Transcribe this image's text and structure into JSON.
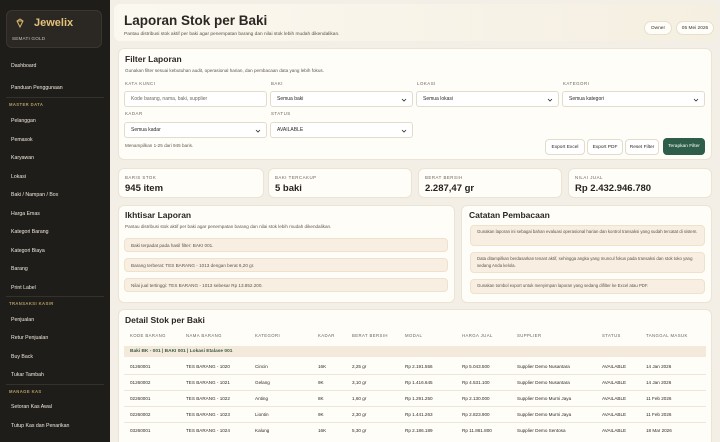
{
  "brand": {
    "name": "Jewelix",
    "subtitle": "SEMATI GOLD"
  },
  "sidebar": {
    "items_top": [
      "Dashboard",
      "Panduan Penggunaan"
    ],
    "section_master": "MASTER DATA",
    "items_master": [
      "Pelanggan",
      "Pemasok",
      "Karyawan",
      "Lokasi",
      "Baki / Nampan / Box",
      "Harga Emas",
      "Kategori Barang",
      "Kategori Biaya",
      "Barang",
      "Print Label"
    ],
    "section_transaksi": "TRANSAKSI KASIR",
    "items_transaksi": [
      "Penjualan",
      "Retur Penjualan",
      "Buy Back",
      "Tukar Tambah"
    ],
    "section_kas": "MANAGE KAS",
    "items_kas": [
      "Setoran Kas Awal",
      "Tutup Kas dan Penarikan"
    ]
  },
  "header": {
    "title": "Laporan Stok per Baki",
    "subtitle": "Pantau distribusi stok aktif per baki agar penempatan barang dan nilai stok lebih mudah dikendalikan.",
    "user": "Owner",
    "date": "05 Mei 2026"
  },
  "filter": {
    "title": "Filter Laporan",
    "subtitle": "Gunakan filter sesuai kebutuhan audit, operasional harian, dan pembacaan data yang lebih fokus.",
    "kata_kunci_label": "KATA KUNCI",
    "kata_kunci_placeholder": "Kode barang, nama, baki, supplier",
    "baki_label": "BAKI",
    "baki_value": "Semua baki",
    "lokasi_label": "LOKASI",
    "lokasi_value": "Semua lokasi",
    "kategori_label": "KATEGORI",
    "kategori_value": "Semua kategori",
    "kadar_label": "KADAR",
    "kadar_value": "Semua kadar",
    "status_label": "STATUS",
    "status_value": "AVAILABLE",
    "showing": "Menampilkan 1-25 dari 945 baris.",
    "export_excel": "Export Excel",
    "export_pdf": "Export PDF",
    "reset": "Reset Filter",
    "apply": "Terapkan Filter"
  },
  "stats": [
    {
      "label": "BARIS STOK",
      "value": "945 item"
    },
    {
      "label": "BAKI TERCAKUP",
      "value": "5 baki"
    },
    {
      "label": "BERAT BERSIH",
      "value": "2.287,47 gr"
    },
    {
      "label": "NILAI JUAL",
      "value": "Rp 2.432.946.780"
    }
  ],
  "ikhtisar": {
    "title": "Ikhtisar Laporan",
    "subtitle": "Pantau distribusi stok aktif per baki agar penempatan barang dan nilai stok lebih mudah dikendalikan.",
    "lines": [
      "Baki terpadat pada hasil filter: BAKI 001.",
      "Barang terberat: TES BARANG - 1013 dengan berat 6,20 gr.",
      "Nilai jual tertinggi: TES BARANG - 1013 sebesar Rp 13.852.200."
    ]
  },
  "catatan": {
    "title": "Catatan Pembacaan",
    "notes": [
      "Gunakan laporan ini sebagai bahan evaluasi operasional harian dan kontrol transaksi yang sudah tercatat di sistem.",
      "Data ditampilkan berdasarkan tenant aktif, sehingga angka yang muncul fokus pada transaksi dan stok toko yang sedang Anda kelola.",
      "Gunakan tombol export untuk menyimpan laporan yang sedang difilter ke Excel atau PDF."
    ]
  },
  "detail": {
    "title": "Detail Stok per Baki",
    "columns": [
      "KODE BARANG",
      "NAMA BARANG",
      "KATEGORI",
      "KADAR",
      "BERAT BERSIH",
      "MODAL",
      "HARGA JUAL",
      "SUPPLIER",
      "STATUS",
      "TANGGAL MASUK"
    ],
    "group": "Baki BK - 001 | BAKI 001 | Lokasi Etalase 001",
    "rows": [
      [
        "01260001",
        "TES BARANG - 1020",
        "Cincin",
        "16K",
        "2,25 gr",
        "Rp 2.191.556",
        "Rp 5.043.500",
        "Supplier Demo Nusantara",
        "AVAILABLE",
        "14 Jan 2026"
      ],
      [
        "01260002",
        "TES BARANG - 1021",
        "Gelang",
        "9K",
        "3,10 gr",
        "Rp 1.416.645",
        "Rp 4.531.100",
        "Supplier Demo Nusantara",
        "AVAILABLE",
        "14 Jan 2026"
      ],
      [
        "02260001",
        "TES BARANG - 1022",
        "Anting",
        "8K",
        "1,60 gr",
        "Rp 1.291.250",
        "Rp 2.130.000",
        "Supplier Demo Murni Jaya",
        "AVAILABLE",
        "11 Feb 2026"
      ],
      [
        "02260002",
        "TES BARANG - 1023",
        "Liontin",
        "9K",
        "2,30 gr",
        "Rp 1.441.263",
        "Rp 2.823.900",
        "Supplier Demo Murni Jaya",
        "AVAILABLE",
        "11 Feb 2026"
      ],
      [
        "03260001",
        "TES BARANG - 1024",
        "Kalung",
        "16K",
        "5,30 gr",
        "Rp 2.186.189",
        "Rp 11.861.800",
        "Supplier Demo Sentosa",
        "AVAILABLE",
        "18 Mar 2026"
      ]
    ]
  },
  "colors": {
    "accent": "#2e5e49",
    "gold": "#d8b66a",
    "sidebar": "#1f1d1a"
  },
  "icons": {
    "brand": "diamond-icon",
    "select": "chevron-down-icon"
  }
}
